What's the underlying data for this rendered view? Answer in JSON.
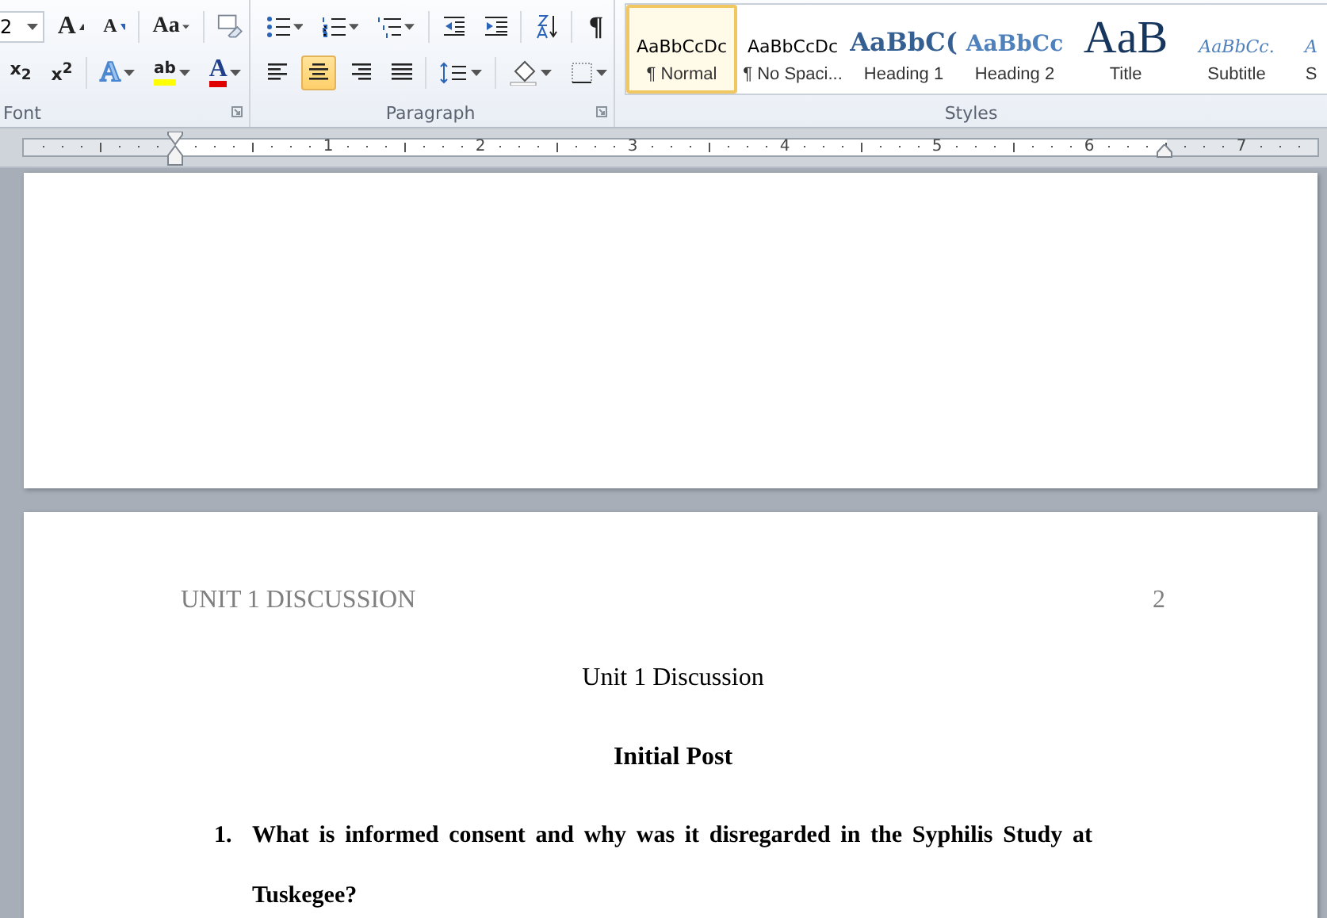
{
  "ribbon": {
    "font": {
      "size_value": "2",
      "row1": [
        {
          "kind": "grow",
          "label": "A"
        },
        {
          "kind": "shrink",
          "label": "A"
        },
        {
          "kind": "case",
          "label": "Aa"
        }
      ],
      "row2": [
        {
          "kind": "script",
          "label": "x$_{2}$"
        },
        {
          "kind": "script",
          "label": "x$^{2}$"
        },
        {
          "kind": "effects",
          "label": "A"
        },
        {
          "kind": "highlight",
          "label": "ab"
        },
        {
          "kind": "color",
          "label": "A"
        }
      ],
      "group_label": "Font"
    },
    "paragraph": {
      "pilcrow": "¶",
      "align": [
        {
          "kind": "left",
          "selected": false
        },
        {
          "kind": "center",
          "selected": true
        },
        {
          "kind": "right",
          "selected": false
        },
        {
          "kind": "justify",
          "selected": false
        }
      ],
      "group_label": "Paragraph"
    },
    "styles": {
      "items": [
        {
          "kind": "normal",
          "preview": "AaBbCcDc",
          "label": "¶ Normal",
          "selected": true
        },
        {
          "kind": "normal",
          "preview": "AaBbCcDc",
          "label": "¶ No Spaci...",
          "selected": false
        },
        {
          "kind": "heading1",
          "preview": "AaBbC(",
          "label": "Heading 1",
          "selected": false
        },
        {
          "kind": "heading2",
          "preview": "AaBbCc",
          "label": "Heading 2",
          "selected": false
        },
        {
          "kind": "title",
          "preview": "AaB",
          "label": "Title",
          "selected": false
        },
        {
          "kind": "subtitle",
          "preview": "AaBbCc.",
          "label": "Subtitle",
          "selected": false
        },
        {
          "kind": "subtitle",
          "preview": "A",
          "label": "S",
          "selected": false
        }
      ],
      "group_label": "Styles"
    }
  },
  "ruler": {
    "numbers": [
      "1",
      "2",
      "3",
      "4",
      "5",
      "6",
      "7"
    ]
  },
  "page": {
    "header": "UNIT 1 DISCUSSION",
    "page_number": "2",
    "title": "Unit 1 Discussion",
    "subtitle": "Initial Post",
    "questions": [
      {
        "number": "1.",
        "text": "What is informed consent and why was it disregarded in the Syphilis Study at Tuskegee?"
      }
    ]
  }
}
